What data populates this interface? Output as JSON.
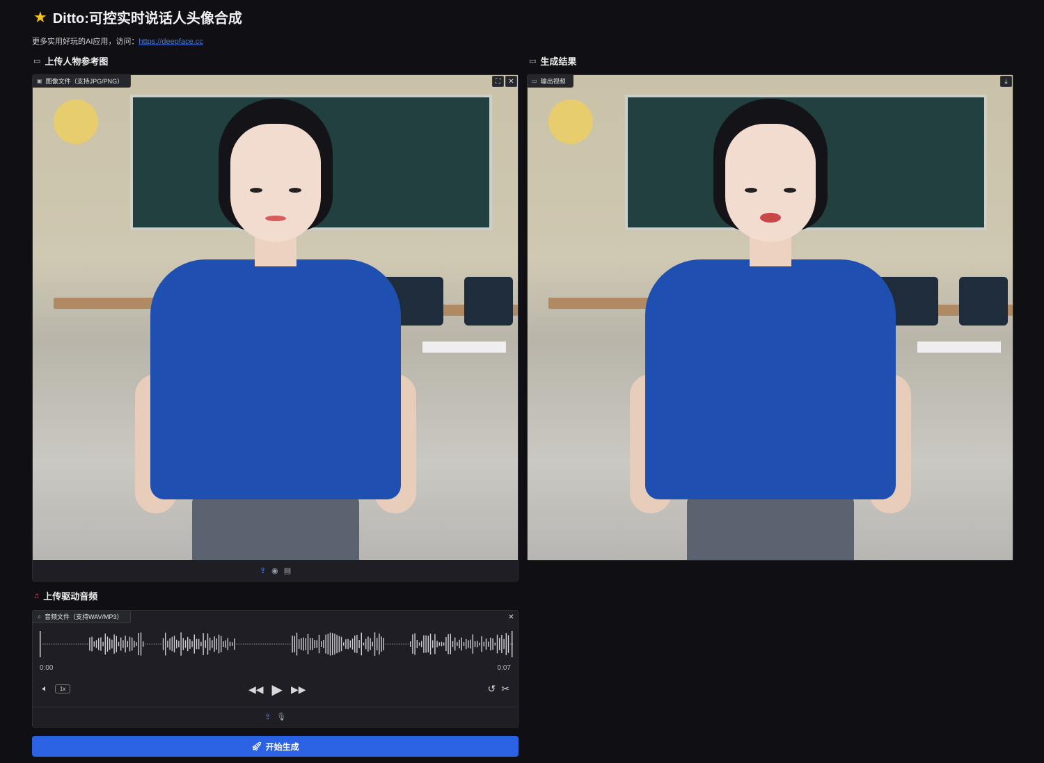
{
  "header": {
    "title": "Ditto:可控实时说话人头像合成",
    "subtitle_prefix": "更多实用好玩的AI应用，访问：",
    "link_text": "https://deepface.cc"
  },
  "sections": {
    "upload_image_label": "上传人物参考图",
    "result_label": "生成结果",
    "upload_audio_label": "上传驱动音频"
  },
  "image_panel": {
    "tag": "图像文件（支持JPG/PNG）"
  },
  "result_panel": {
    "tag": "输出视频"
  },
  "audio_panel": {
    "tag": "音频文件（支持WAV/MP3）",
    "time_start": "0:00",
    "time_end": "0:07",
    "speed": "1x"
  },
  "generate_button": {
    "label": "开始生成"
  },
  "colors": {
    "accent": "#2b62e3",
    "background": "#0f0f14",
    "panel": "#1e1e24",
    "link": "#4a7bdc"
  }
}
